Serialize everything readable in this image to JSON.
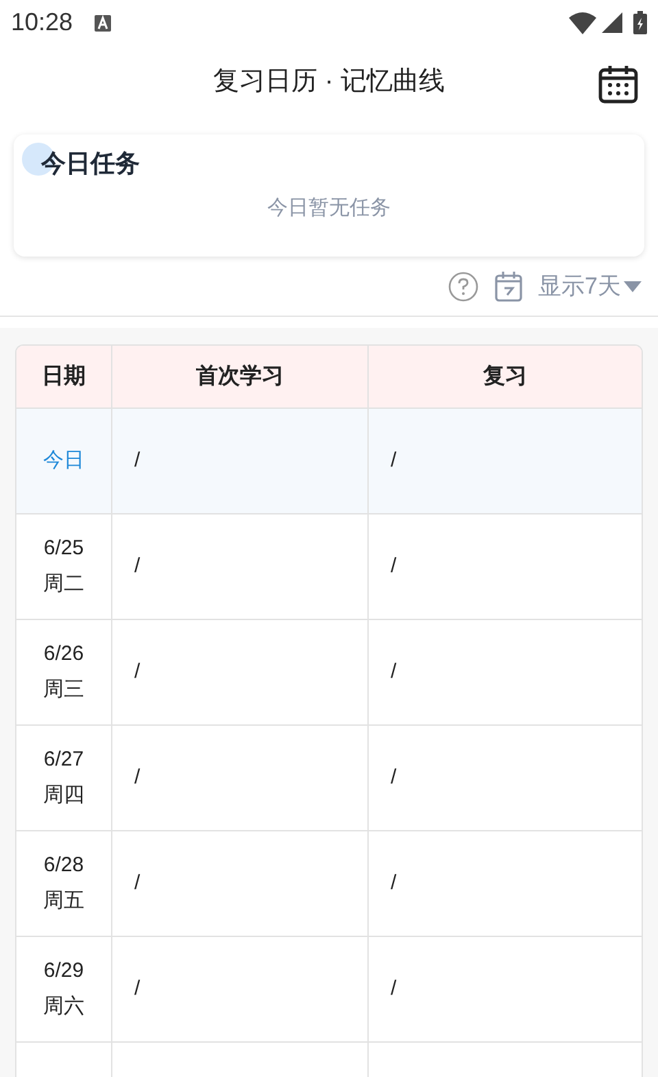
{
  "status_bar": {
    "time": "10:28"
  },
  "header": {
    "title": "复习日历 · 记忆曲线"
  },
  "today_card": {
    "title": "今日任务",
    "empty_text": "今日暂无任务"
  },
  "toolbar": {
    "range_label": "显示7天"
  },
  "table": {
    "columns": [
      "日期",
      "首次学习",
      "复习"
    ],
    "rows": [
      {
        "today": true,
        "date": "今日",
        "first_study": "/",
        "review": "/"
      },
      {
        "today": false,
        "date": "6/25",
        "weekday": "周二",
        "first_study": "/",
        "review": "/"
      },
      {
        "today": false,
        "date": "6/26",
        "weekday": "周三",
        "first_study": "/",
        "review": "/"
      },
      {
        "today": false,
        "date": "6/27",
        "weekday": "周四",
        "first_study": "/",
        "review": "/"
      },
      {
        "today": false,
        "date": "6/28",
        "weekday": "周五",
        "first_study": "/",
        "review": "/"
      },
      {
        "today": false,
        "date": "6/29",
        "weekday": "周六",
        "first_study": "/",
        "review": "/"
      }
    ]
  }
}
